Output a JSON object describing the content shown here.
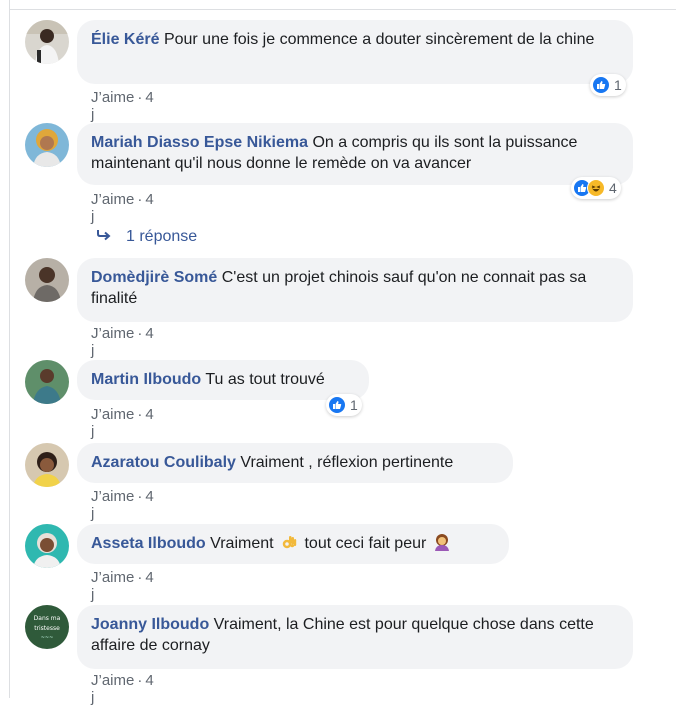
{
  "comments": [
    {
      "author": "Élie Kéré",
      "text": "Pour une fois je commence a douter sincèrement de la chine",
      "like_label": "J’aime",
      "time": "4 j",
      "reaction_count": "1"
    },
    {
      "author": "Mariah Diasso Epse Nikiema",
      "text": "On a compris qu ils sont la puissance maintenant qu'il nous donne le remède on va avancer",
      "like_label": "J’aime",
      "time": "4 j",
      "reaction_count": "4"
    },
    {
      "author": "Domèdjirè Somé",
      "text": "C'est un projet chinois sauf qu'on ne connait pas sa finalité",
      "like_label": "J’aime",
      "time": "4 j"
    },
    {
      "author": "Martin Ilboudo",
      "text": "Tu as tout trouvé",
      "like_label": "J’aime",
      "time": "4 j",
      "reaction_count": "1"
    },
    {
      "author": "Azaratou Coulibaly",
      "text": "Vraiment , réflexion pertinente",
      "like_label": "J’aime",
      "time": "4 j"
    },
    {
      "author": "Asseta Ilboudo",
      "text_before": "Vraiment",
      "text_middle": "tout ceci fait peur",
      "like_label": "J’aime",
      "time": "4 j"
    },
    {
      "author": "Joanny Ilboudo",
      "text": "Vraiment, la Chine est pour quelque chose dans cette affaire de cornay",
      "like_label": "J’aime",
      "time": "4 j",
      "avatar_text": "Dans ma tristesse"
    }
  ],
  "reply": {
    "label": "1 réponse"
  },
  "colors": {
    "author": "#385898",
    "bubble": "#f2f3f5",
    "meta": "#606770",
    "like": "#1877f2",
    "haha": "#f7b928"
  }
}
